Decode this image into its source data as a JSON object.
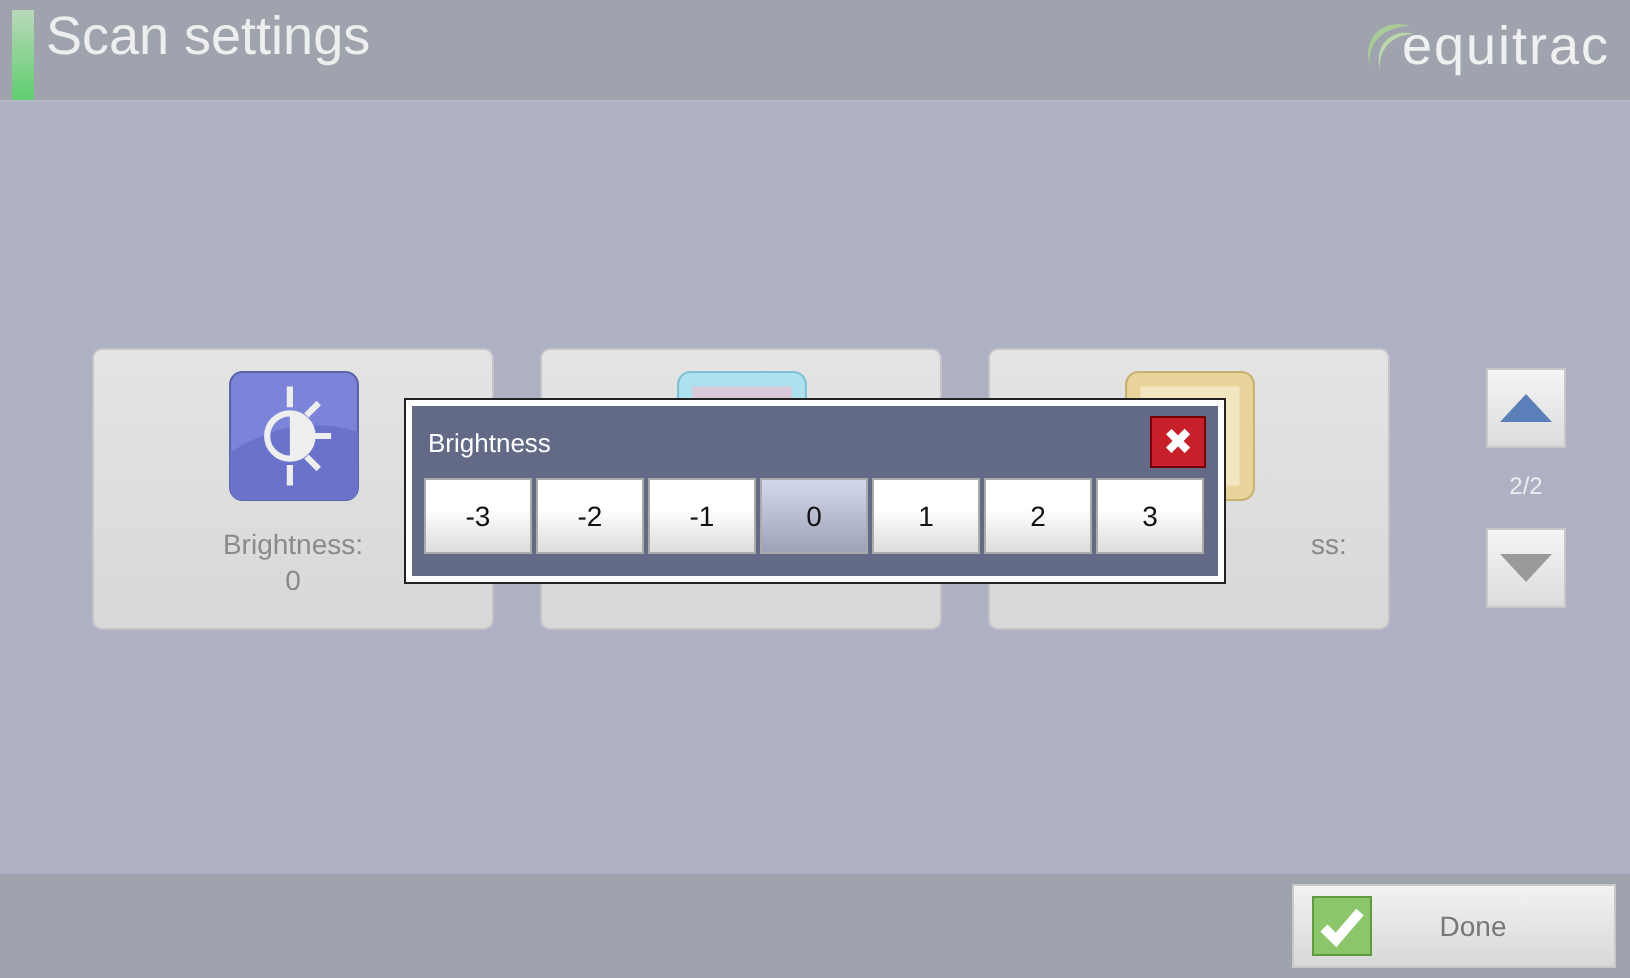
{
  "header": {
    "title": "Scan settings",
    "logo": "equitrac"
  },
  "cards": [
    {
      "kind": "brightness",
      "label": "Brightness:",
      "value": "0"
    },
    {
      "kind": "image"
    },
    {
      "kind": "yellow",
      "label": "ss:"
    }
  ],
  "pager": {
    "text": "2/2"
  },
  "dialog": {
    "title": "Brightness",
    "close": "✖",
    "options": [
      {
        "label": "-3",
        "selected": false
      },
      {
        "label": "-2",
        "selected": false
      },
      {
        "label": "-1",
        "selected": false
      },
      {
        "label": "0",
        "selected": true
      },
      {
        "label": "1",
        "selected": false
      },
      {
        "label": "2",
        "selected": false
      },
      {
        "label": "3",
        "selected": false
      }
    ]
  },
  "footer": {
    "done": "Done"
  }
}
